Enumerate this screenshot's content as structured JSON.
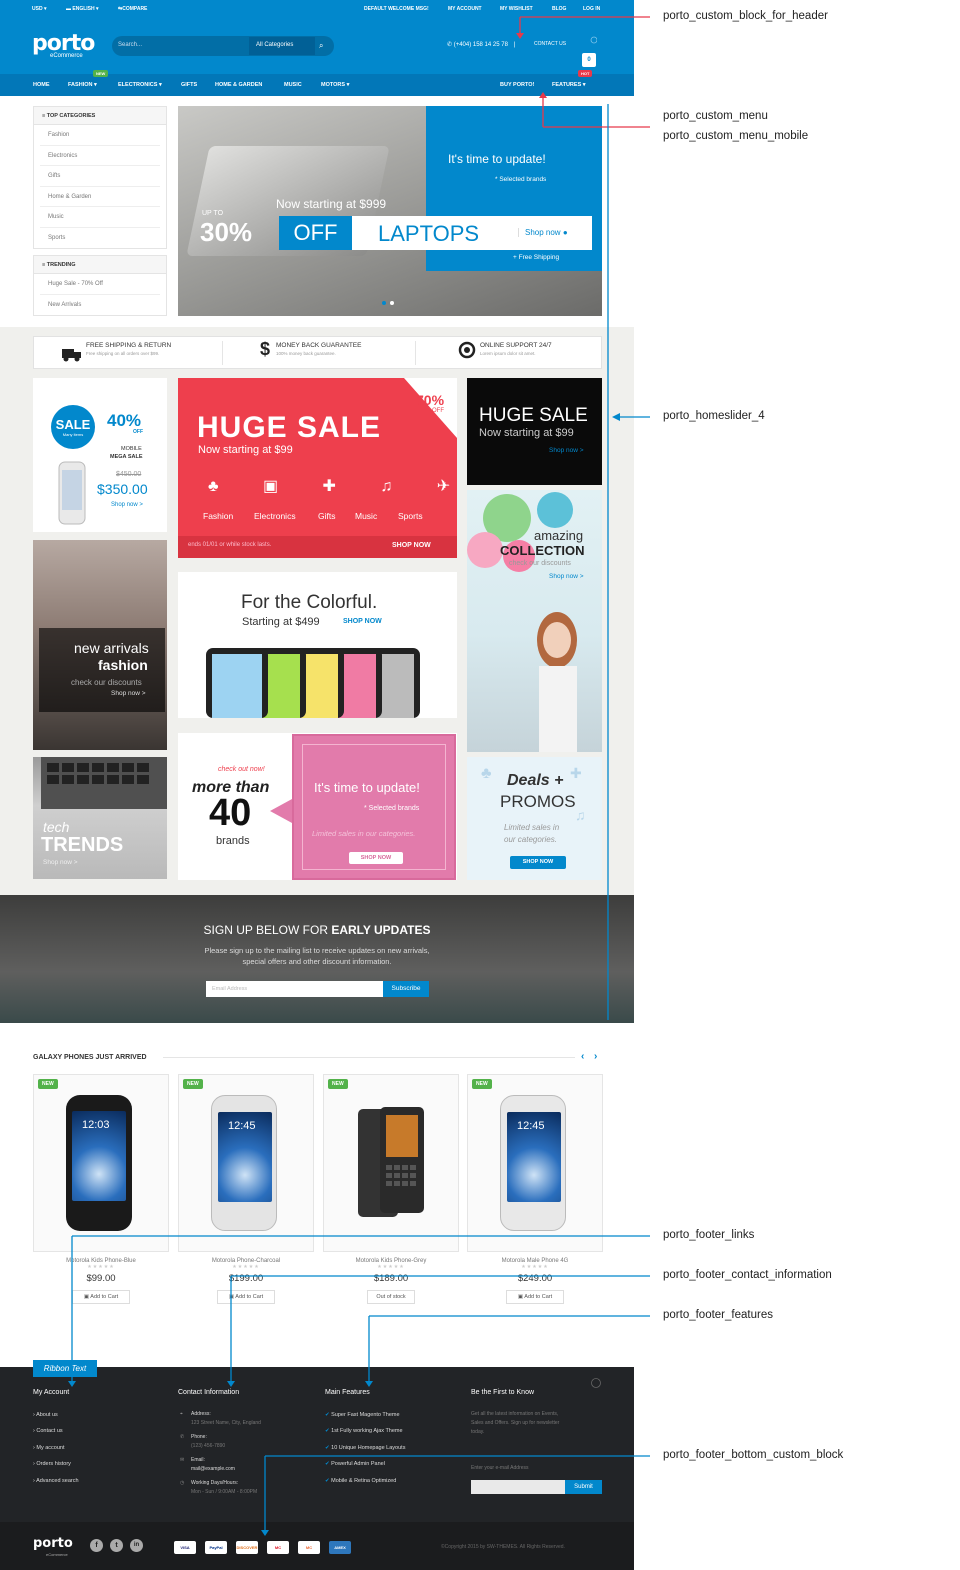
{
  "topbar": {
    "currency": "USD ▾",
    "language": "ENGLISH ▾",
    "compare": "COMPARE",
    "welcome": "DEFAULT WELCOME MSG!",
    "account": "MY ACCOUNT",
    "wishlist": "MY WISHLIST",
    "blog": "BLOG",
    "login": "LOG IN"
  },
  "header": {
    "logo": "porto",
    "logo_sub": "eCommerce",
    "search_placeholder": "Search...",
    "search_category": "All Categories",
    "phone": "(+404) 158 14 25 78",
    "contact": "CONTACT US",
    "cart_count": "0"
  },
  "nav": {
    "home": "HOME",
    "fashion": "FASHION ▾",
    "fashion_badge": "NEW",
    "electronics": "ELECTRONICS ▾",
    "gifts": "GIFTS",
    "home_garden": "HOME & GARDEN",
    "music": "MUSIC",
    "motors": "MOTORS ▾",
    "buy": "BUY PORTO!",
    "features": "FEATURES ▾",
    "features_badge": "HOT"
  },
  "sidebar": {
    "top_title": "TOP CATEGORIES",
    "top_items": [
      "Fashion",
      "Electronics",
      "Gifts",
      "Home & Garden",
      "Music",
      "Sports"
    ],
    "trend_title": "TRENDING",
    "trend_items": [
      "Huge Sale - 70% Off",
      "New Arrivals"
    ]
  },
  "slider": {
    "tagline": "It's time to update!",
    "brands": "* Selected brands",
    "starting": "Now starting at $999",
    "upto": "UP TO",
    "percent": "30%",
    "off": "OFF",
    "laptops": "LAPTOPS",
    "shop": "Shop now",
    "shipping": "+ Free Shipping"
  },
  "features": [
    {
      "title": "FREE SHIPPING & RETURN",
      "desc": "Free shipping on all orders over $99."
    },
    {
      "title": "MONEY BACK GUARANTEE",
      "desc": "100% money back guarantee."
    },
    {
      "title": "ONLINE SUPPORT 24/7",
      "desc": "Lorem ipsum dolor sit amet."
    }
  ],
  "banners": {
    "sale_word": "SALE",
    "sale_sub": "Many items",
    "sale_pct": "40%",
    "sale_off": "OFF",
    "mobile1": "MOBILE",
    "mobile2": "MEGA SALE",
    "old_price": "$450.00",
    "new_price": "$350.00",
    "shop1": "Shop now >",
    "huge_title": "HUGE SALE",
    "huge_sub": "Now starting at $99",
    "huge_pct": "70%",
    "huge_off": "OFF",
    "cats": [
      "Fashion",
      "Electronics",
      "Gifts",
      "Music",
      "Sports"
    ],
    "huge_ends": "ends 01/01 or while stock lasts.",
    "huge_shop": "SHOP NOW",
    "dark_title": "HUGE SALE",
    "dark_sub": "Now starting at $99",
    "dark_shop": "Shop now >",
    "arr1": "new arrivals",
    "arr2": "fashion",
    "arr3": "check our discounts",
    "arr4": "Shop now >",
    "col_title": "For the Colorful.",
    "col_start": "Starting at $499",
    "col_shop": "SHOP NOW",
    "amz1": "amazing",
    "amz2": "COLLECTION",
    "amz3": "check our discounts",
    "amz4": "Shop now >",
    "tech1": "tech",
    "tech2": "TRENDS",
    "tech3": "Shop now >",
    "brands1": "check out now!",
    "brands2": "more than",
    "brands3": "40",
    "brands4": "brands",
    "pink1": "It's time to update!",
    "pink2": "* Selected brands",
    "pink3": "Limited sales in our categories.",
    "pink4": "SHOP NOW",
    "deals1": "Deals +",
    "deals2": "PROMOS",
    "deals3": "Limited sales in",
    "deals4": "our categories.",
    "deals5": "SHOP NOW"
  },
  "newsletter": {
    "title_a": "SIGN UP BELOW FOR ",
    "title_b": "EARLY UPDATES",
    "text1": "Please sign up to the mailing list to receive updates on new arrivals,",
    "text2": "special offers and other discount information.",
    "placeholder": "Email Address",
    "button": "Subscribe"
  },
  "products": {
    "title": "GALAXY PHONES JUST ARRIVED",
    "items": [
      {
        "badge": "NEW",
        "name": "Motorola Kids Phone-Blue",
        "price": "$99.00",
        "action": "Add to Cart",
        "screen": "12:03"
      },
      {
        "badge": "NEW",
        "name": "Motorola Phone-Charcoal",
        "price": "$199.00",
        "action": "Add to Cart",
        "screen": "12:45"
      },
      {
        "badge": "NEW",
        "name": "Motorola Kids Phone-Grey",
        "price": "$189.00",
        "action": "Out of stock",
        "screen": ""
      },
      {
        "badge": "NEW",
        "name": "Motorola Male Phone 4G",
        "price": "$249.00",
        "action": "Add to Cart",
        "screen": "12:45"
      }
    ],
    "stars": "★★★★★"
  },
  "footer": {
    "ribbon": "Ribbon Text",
    "account_title": "My Account",
    "account_links": [
      "About us",
      "Contact us",
      "My account",
      "Orders history",
      "Advanced search"
    ],
    "contact_title": "Contact Information",
    "address_label": "Address:",
    "address": "123 Street Name, City, England",
    "phone_label": "Phone:",
    "phone": "(123) 456-7890",
    "email_label": "Email:",
    "email": "mail@example.com",
    "hours_label": "Working Days/Hours:",
    "hours": "Mon - Sun / 9:00AM - 8:00PM",
    "features_title": "Main Features",
    "features_links": [
      "Super Fast Magento Theme",
      "1st Fully working Ajax Theme",
      "10 Unique Homepage Layouts",
      "Powerful Admin Panel",
      "Mobile & Retina Optimized"
    ],
    "news_title": "Be the First to Know",
    "news_text1": "Get all the latest information on Events,",
    "news_text2": "Sales and Offers. Sign up for newsletter",
    "news_text3": "today.",
    "news_label": "Enter your e-mail Address",
    "news_button": "Submit",
    "logo": "porto",
    "logo_sub": "eCommerce",
    "payments": [
      "VISA",
      "PayPal",
      "DISCOVER",
      "MC",
      "MC",
      "AMEX"
    ],
    "copyright": "©Copyright 2015 by SW-THEMES. All Rights Reserved."
  },
  "annotations": {
    "a1": "porto_custom_block_for_header",
    "a2": "porto_custom_menu",
    "a3": "porto_custom_menu_mobile",
    "a4": "porto_homeslider_4",
    "a5": "porto_footer_links",
    "a6": "porto_footer_contact_information",
    "a7": "porto_footer_features",
    "a8": "porto_footer_bottom_custom_block"
  },
  "colors": {
    "primary": "#0288cc",
    "sale_red": "#ee3f4d",
    "pink": "#e27bab",
    "annotation_red": "#e8394a",
    "annotation_blue": "#0288cc"
  }
}
